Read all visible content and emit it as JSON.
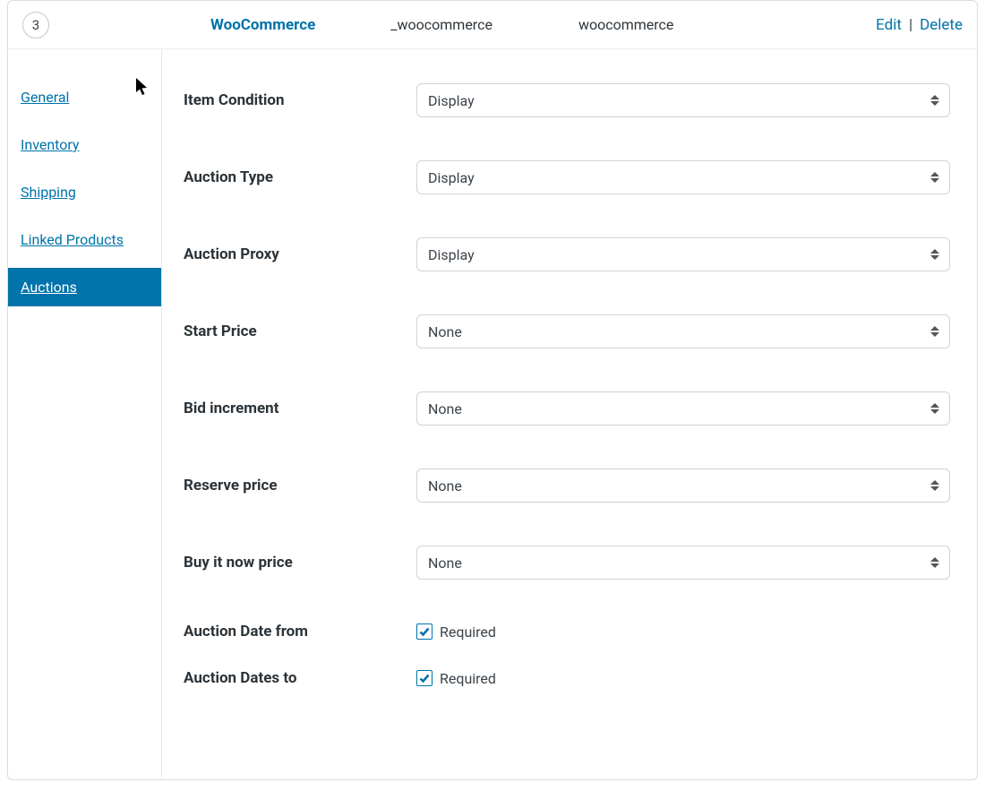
{
  "header": {
    "page_number": "3",
    "title": "WooCommerce",
    "mid1": "_woocommerce",
    "mid2": "woocommerce",
    "edit": "Edit",
    "sep": "|",
    "delete": "Delete"
  },
  "sidebar": {
    "items": [
      {
        "label": "General"
      },
      {
        "label": "Inventory"
      },
      {
        "label": "Shipping"
      },
      {
        "label": "Linked Products"
      },
      {
        "label": "Auctions"
      }
    ],
    "active_index": 4
  },
  "fields": {
    "item_condition": {
      "label": "Item Condition",
      "value": "Display"
    },
    "auction_type": {
      "label": "Auction Type",
      "value": "Display"
    },
    "auction_proxy": {
      "label": "Auction Proxy",
      "value": "Display"
    },
    "start_price": {
      "label": "Start Price",
      "value": "None"
    },
    "bid_increment": {
      "label": "Bid increment",
      "value": "None"
    },
    "reserve_price": {
      "label": "Reserve price",
      "value": "None"
    },
    "buy_it_now_price": {
      "label": "Buy it now price",
      "value": "None"
    },
    "auction_date_from": {
      "label": "Auction Date from",
      "required_label": "Required"
    },
    "auction_dates_to": {
      "label": "Auction Dates to",
      "required_label": "Required"
    }
  }
}
